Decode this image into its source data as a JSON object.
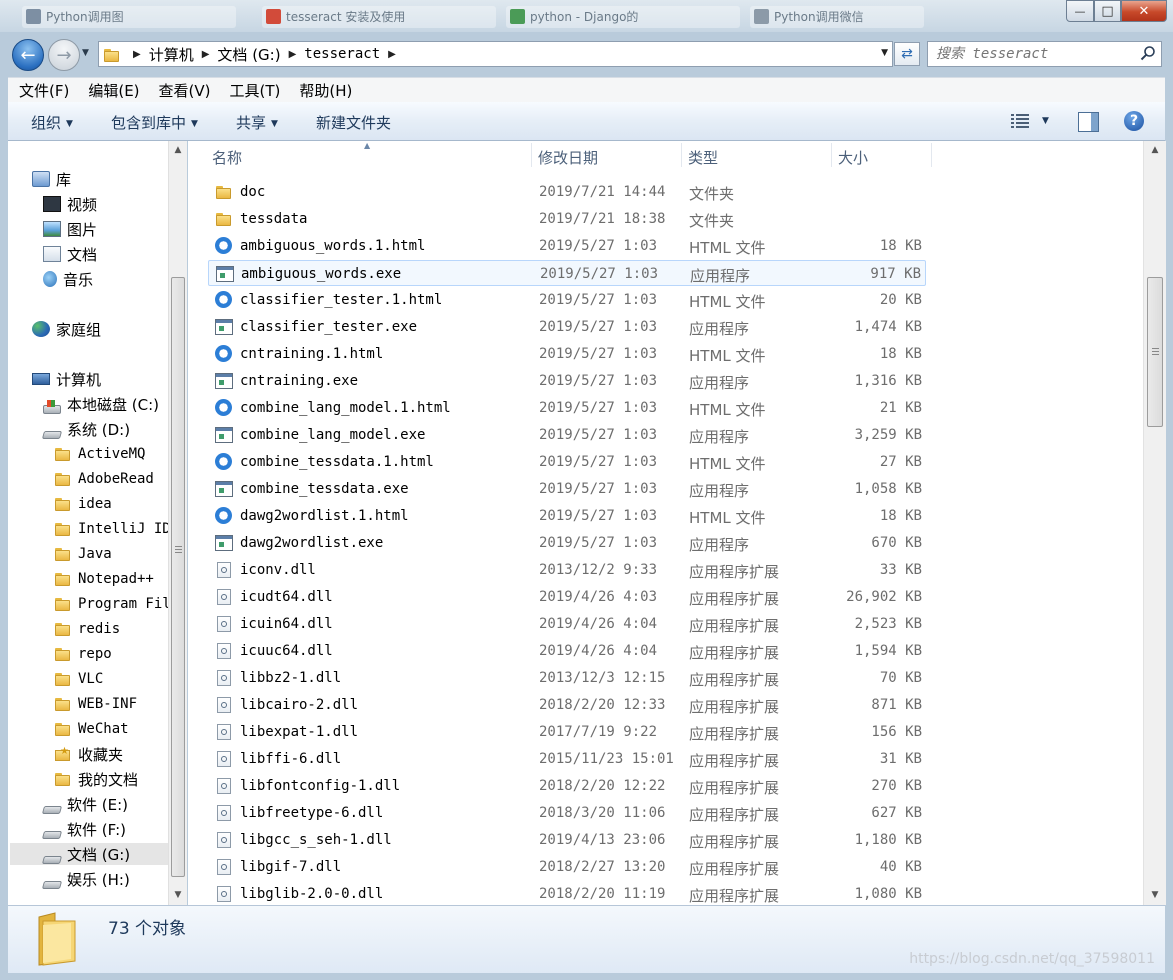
{
  "window": {
    "background_tabs": [
      {
        "label": "Python调用图",
        "color": "#7d8fa3",
        "left": 0
      },
      {
        "label": "tesseract 安装及使用",
        "color": "#d24b3a",
        "left": 0
      },
      {
        "label": "python - Django的",
        "color": "#4b9b57",
        "left": 0
      },
      {
        "label": "Python调用微信",
        "color": "#8c9aa8",
        "left": 0
      }
    ],
    "controls": {
      "minimize": "—",
      "maximize": "□",
      "close": "✕"
    }
  },
  "address": {
    "crumbs": [
      "计算机",
      "文档 (G:)",
      "tesseract"
    ],
    "search_placeholder": "搜索 tesseract"
  },
  "menu": [
    "文件(F)",
    "编辑(E)",
    "查看(V)",
    "工具(T)",
    "帮助(H)"
  ],
  "toolbar": {
    "organize": "组织",
    "include_library": "包含到库中",
    "share": "共享",
    "new_folder": "新建文件夹"
  },
  "nav": {
    "libraries": {
      "label": "库",
      "items": [
        "视频",
        "图片",
        "文档",
        "音乐"
      ]
    },
    "homegroup": "家庭组",
    "computer": {
      "label": "计算机",
      "drives": [
        {
          "label": "本地磁盘 (C:)",
          "icon": "drive-windows-icon"
        },
        {
          "label": "系统 (D:)",
          "icon": "drive-icon"
        }
      ],
      "folders": [
        "ActiveMQ",
        "AdobeRead",
        "idea",
        "IntelliJ ID",
        "Java",
        "Notepad++",
        "Program Fil",
        "redis",
        "repo",
        "VLC",
        "WEB-INF",
        "WeChat",
        "收藏夹",
        "我的文档"
      ],
      "more_drives": [
        "软件 (E:)",
        "软件 (F:)",
        "文档 (G:)",
        "娱乐 (H:)"
      ],
      "selected_drive": "文档 (G:)"
    }
  },
  "columns": {
    "name": "名称",
    "date": "修改日期",
    "type": "类型",
    "size": "大小"
  },
  "files": [
    {
      "name": "doc",
      "date": "2019/7/21 14:44",
      "type": "文件夹",
      "size": "",
      "icon": "folder"
    },
    {
      "name": "tessdata",
      "date": "2019/7/21 18:38",
      "type": "文件夹",
      "size": "",
      "icon": "folder"
    },
    {
      "name": "ambiguous_words.1.html",
      "date": "2019/5/27 1:03",
      "type": "HTML 文件",
      "size": "18 KB",
      "icon": "html"
    },
    {
      "name": "ambiguous_words.exe",
      "date": "2019/5/27 1:03",
      "type": "应用程序",
      "size": "917 KB",
      "icon": "exe"
    },
    {
      "name": "classifier_tester.1.html",
      "date": "2019/5/27 1:03",
      "type": "HTML 文件",
      "size": "20 KB",
      "icon": "html"
    },
    {
      "name": "classifier_tester.exe",
      "date": "2019/5/27 1:03",
      "type": "应用程序",
      "size": "1,474 KB",
      "icon": "exe"
    },
    {
      "name": "cntraining.1.html",
      "date": "2019/5/27 1:03",
      "type": "HTML 文件",
      "size": "18 KB",
      "icon": "html"
    },
    {
      "name": "cntraining.exe",
      "date": "2019/5/27 1:03",
      "type": "应用程序",
      "size": "1,316 KB",
      "icon": "exe"
    },
    {
      "name": "combine_lang_model.1.html",
      "date": "2019/5/27 1:03",
      "type": "HTML 文件",
      "size": "21 KB",
      "icon": "html"
    },
    {
      "name": "combine_lang_model.exe",
      "date": "2019/5/27 1:03",
      "type": "应用程序",
      "size": "3,259 KB",
      "icon": "exe"
    },
    {
      "name": "combine_tessdata.1.html",
      "date": "2019/5/27 1:03",
      "type": "HTML 文件",
      "size": "27 KB",
      "icon": "html"
    },
    {
      "name": "combine_tessdata.exe",
      "date": "2019/5/27 1:03",
      "type": "应用程序",
      "size": "1,058 KB",
      "icon": "exe"
    },
    {
      "name": "dawg2wordlist.1.html",
      "date": "2019/5/27 1:03",
      "type": "HTML 文件",
      "size": "18 KB",
      "icon": "html"
    },
    {
      "name": "dawg2wordlist.exe",
      "date": "2019/5/27 1:03",
      "type": "应用程序",
      "size": "670 KB",
      "icon": "exe"
    },
    {
      "name": "iconv.dll",
      "date": "2013/12/2 9:33",
      "type": "应用程序扩展",
      "size": "33 KB",
      "icon": "dll"
    },
    {
      "name": "icudt64.dll",
      "date": "2019/4/26 4:03",
      "type": "应用程序扩展",
      "size": "26,902 KB",
      "icon": "dll"
    },
    {
      "name": "icuin64.dll",
      "date": "2019/4/26 4:04",
      "type": "应用程序扩展",
      "size": "2,523 KB",
      "icon": "dll"
    },
    {
      "name": "icuuc64.dll",
      "date": "2019/4/26 4:04",
      "type": "应用程序扩展",
      "size": "1,594 KB",
      "icon": "dll"
    },
    {
      "name": "libbz2-1.dll",
      "date": "2013/12/3 12:15",
      "type": "应用程序扩展",
      "size": "70 KB",
      "icon": "dll"
    },
    {
      "name": "libcairo-2.dll",
      "date": "2018/2/20 12:33",
      "type": "应用程序扩展",
      "size": "871 KB",
      "icon": "dll"
    },
    {
      "name": "libexpat-1.dll",
      "date": "2017/7/19 9:22",
      "type": "应用程序扩展",
      "size": "156 KB",
      "icon": "dll"
    },
    {
      "name": "libffi-6.dll",
      "date": "2015/11/23 15:01",
      "type": "应用程序扩展",
      "size": "31 KB",
      "icon": "dll"
    },
    {
      "name": "libfontconfig-1.dll",
      "date": "2018/2/20 12:22",
      "type": "应用程序扩展",
      "size": "270 KB",
      "icon": "dll"
    },
    {
      "name": "libfreetype-6.dll",
      "date": "2018/3/20 11:06",
      "type": "应用程序扩展",
      "size": "627 KB",
      "icon": "dll"
    },
    {
      "name": "libgcc_s_seh-1.dll",
      "date": "2019/4/13 23:06",
      "type": "应用程序扩展",
      "size": "1,180 KB",
      "icon": "dll"
    },
    {
      "name": "libgif-7.dll",
      "date": "2018/2/27 13:20",
      "type": "应用程序扩展",
      "size": "40 KB",
      "icon": "dll"
    },
    {
      "name": "libglib-2.0-0.dll",
      "date": "2018/2/20 11:19",
      "type": "应用程序扩展",
      "size": "1,080 KB",
      "icon": "dll"
    }
  ],
  "hovered_file": "ambiguous_words.exe",
  "status": {
    "object_count": "73 个对象"
  },
  "watermark": "https://blog.csdn.net/qq_37598011"
}
